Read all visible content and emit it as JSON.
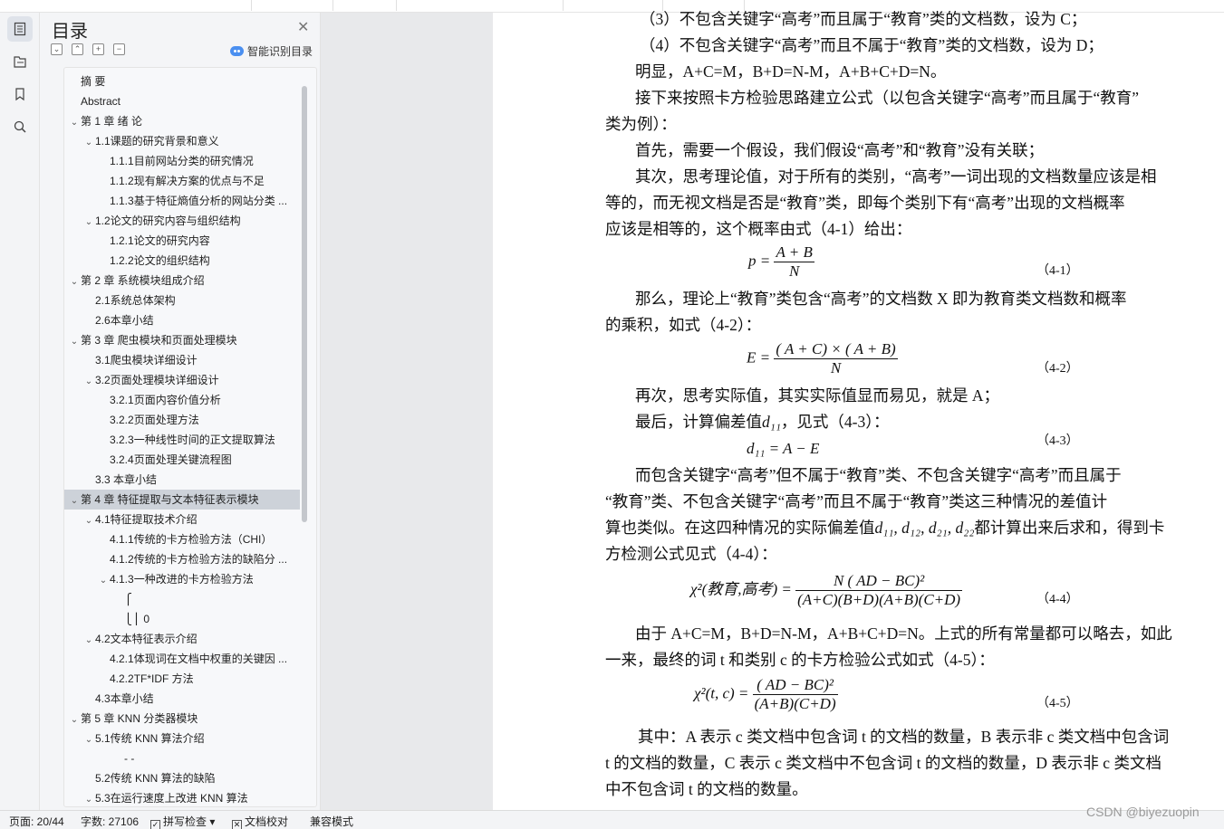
{
  "toc": {
    "title": "目录",
    "ai_label": "智能识别目录",
    "items": [
      {
        "text": "摘 要",
        "level": 1,
        "chev": ""
      },
      {
        "text": "Abstract",
        "level": 1,
        "chev": ""
      },
      {
        "text": "第 1 章 绪 论",
        "level": 1,
        "chev": "v"
      },
      {
        "text": "1.1课题的研究背景和意义",
        "level": 2,
        "chev": "v"
      },
      {
        "text": "1.1.1目前网站分类的研究情况",
        "level": 3,
        "chev": ""
      },
      {
        "text": "1.1.2现有解决方案的优点与不足",
        "level": 3,
        "chev": ""
      },
      {
        "text": "1.1.3基于特征熵值分析的网站分类 ...",
        "level": 3,
        "chev": ""
      },
      {
        "text": "1.2论文的研究内容与组织结构",
        "level": 2,
        "chev": "v"
      },
      {
        "text": "1.2.1论文的研究内容",
        "level": 3,
        "chev": ""
      },
      {
        "text": "1.2.2论文的组织结构",
        "level": 3,
        "chev": ""
      },
      {
        "text": "第 2 章 系统模块组成介绍",
        "level": 1,
        "chev": "v"
      },
      {
        "text": "2.1系统总体架构",
        "level": 2,
        "chev": ""
      },
      {
        "text": "2.6本章小结",
        "level": 2,
        "chev": ""
      },
      {
        "text": "第 3 章 爬虫模块和页面处理模块",
        "level": 1,
        "chev": "v"
      },
      {
        "text": "3.1爬虫模块详细设计",
        "level": 2,
        "chev": ""
      },
      {
        "text": "3.2页面处理模块详细设计",
        "level": 2,
        "chev": "v"
      },
      {
        "text": "3.2.1页面内容价值分析",
        "level": 3,
        "chev": ""
      },
      {
        "text": "3.2.2页面处理方法",
        "level": 3,
        "chev": ""
      },
      {
        "text": "3.2.3一种线性时间的正文提取算法",
        "level": 3,
        "chev": ""
      },
      {
        "text": "3.2.4页面处理关键流程图",
        "level": 3,
        "chev": ""
      },
      {
        "text": "3.3 本章小结",
        "level": 2,
        "chev": ""
      },
      {
        "text": "第 4 章 特征提取与文本特征表示模块",
        "level": 1,
        "chev": "v",
        "selected": true
      },
      {
        "text": "4.1特征提取技术介绍",
        "level": 2,
        "chev": "v"
      },
      {
        "text": "4.1.1传统的卡方检验方法（CHI）",
        "level": 3,
        "chev": ""
      },
      {
        "text": "4.1.2传统的卡方检验方法的缺陷分 ...",
        "level": 3,
        "chev": ""
      },
      {
        "text": "4.1.3一种改进的卡方检验方法",
        "level": 3,
        "chev": "v"
      },
      {
        "text": "⎧",
        "level": 4,
        "chev": ""
      },
      {
        "text": "⎩⎪ 0",
        "level": 4,
        "chev": ""
      },
      {
        "text": "4.2文本特征表示介绍",
        "level": 2,
        "chev": "v"
      },
      {
        "text": "4.2.1体现词在文档中权重的关键因 ...",
        "level": 3,
        "chev": ""
      },
      {
        "text": "4.2.2TF*IDF 方法",
        "level": 3,
        "chev": ""
      },
      {
        "text": "4.3本章小结",
        "level": 2,
        "chev": ""
      },
      {
        "text": "第 5 章 KNN 分类器模块",
        "level": 1,
        "chev": "v"
      },
      {
        "text": "5.1传统 KNN 算法介绍",
        "level": 2,
        "chev": "v"
      },
      {
        "text": "- -",
        "level": 4,
        "chev": ""
      },
      {
        "text": "5.2传统 KNN 算法的缺陷",
        "level": 2,
        "chev": ""
      },
      {
        "text": "5.3在运行速度上改进 KNN 算法",
        "level": 2,
        "chev": "v"
      }
    ]
  },
  "doc": {
    "lines": [
      "（3）不包含关键字“高考”而且属于“教育”类的文档数，设为 C；",
      "（4）不包含关键字“高考”而且不属于“教育”类的文档数，设为 D；",
      "明显，A+C=M，B+D=N-M，A+B+C+D=N。",
      "接下来按照卡方检验思路建立公式（以包含关键字“高考”而且属于“教育”",
      "类为例）：",
      "首先，需要一个假设，我们假设“高考”和“教育”没有关联；",
      "其次，思考理论值，对于所有的类别，“高考”一词出现的文档数量应该是相",
      "等的，而无视文档是否是“教育”类，即每个类别下有“高考”出现的文档概率",
      "应该是相等的，这个概率由式（4-1）给出：",
      "那么，理论上“教育”类包含“高考”的文档数 X 即为教育类文档数和概率",
      "的乘积，如式（4-2）：",
      "再次，思考实际值，其实实际值显而易见，就是 A；",
      "最后，计算偏差值",
      "，见式（4-3）：",
      "而包含关键字“高考”但不属于“教育”类、不包含关键字“高考”而且属于",
      "“教育”类、不包含关键字“高考”而且不属于“教育”类这三种情况的差值计",
      "算也类似。在这四种情况的实际偏差值",
      "都计算出来后求和，得到卡",
      "方检测公式见式（4-4）：",
      "由于 A+C=M，B+D=N-M，A+B+C+D=N。上式的所有常量都可以略去，如此",
      "一来，最终的词 t 和类别 c 的卡方检验公式如式（4-5）：",
      "其中：A 表示 c 类文档中包含词 t 的文档的数量，B 表示非 c 类文档中包含词",
      "t 的文档的数量，C 表示 c 类文档中不包含词 t 的文档的数量，D 表示非 c 类文档",
      "中不包含词 t 的文档的数量。"
    ],
    "eq": {
      "e1_lhs": "p =",
      "e1_num": "A + B",
      "e1_den": "N",
      "e1_tag": "（4-1）",
      "e2_lhs": "E =",
      "e2_num": "( A + C) × ( A + B)",
      "e2_den": "N",
      "e2_tag": "（4-2）",
      "e3_body": "d₁₁ = A − E",
      "e3_tag": "（4-3）",
      "d11_inline": "d₁₁",
      "dlist_inline": "d₁₁, d₁₂, d₂₁, d₂₂",
      "e4_lhs": "χ²(教育,高考) =",
      "e4_num": "N ( AD − BC)²",
      "e4_den": "(A+C)(B+D)(A+B)(C+D)",
      "e4_tag": "（4-4）",
      "e5_lhs": "χ²(t, c) =",
      "e5_num": "( AD − BC)²",
      "e5_den": "(A+B)(C+D)",
      "e5_tag": "（4-5）"
    }
  },
  "status": {
    "page": "页面: 20/44",
    "words": "字数: 27106",
    "spell": "拼写检查",
    "proof": "文档校对",
    "compat": "兼容模式"
  },
  "watermark": "CSDN @biyezuopin"
}
